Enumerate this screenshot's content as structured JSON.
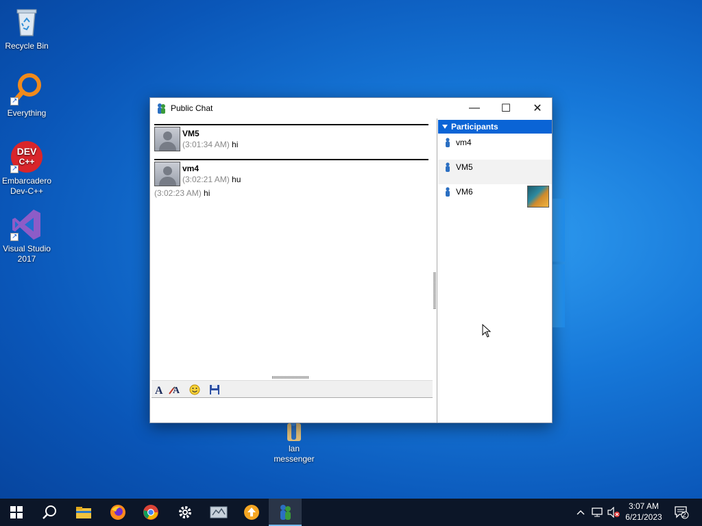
{
  "desktop": {
    "icons": [
      {
        "label_line1": "Recycle Bin",
        "label_line2": "",
        "icon": "recycle-bin-icon"
      },
      {
        "label_line1": "Everything",
        "label_line2": "",
        "icon": "everything-search-icon"
      },
      {
        "label_line1": "Embarcadero",
        "label_line2": "Dev-C++",
        "icon": "dev-cpp-icon",
        "badge": "DEV C++"
      },
      {
        "label_line1": "Visual Studio",
        "label_line2": "2017",
        "icon": "visual-studio-icon"
      },
      {
        "label_line1": "lan",
        "label_line2": "messenger",
        "icon": "lan-messenger-icon"
      }
    ]
  },
  "window": {
    "title": "Public Chat",
    "controls": {
      "minimize": "—",
      "maximize": "☐",
      "close": "✕"
    }
  },
  "messages": [
    {
      "sender": "VM5",
      "lines": [
        {
          "time": "(3:01:34 AM)",
          "text": "hi"
        }
      ]
    },
    {
      "sender": "vm4",
      "lines": [
        {
          "time": "(3:02:21 AM)",
          "text": "hu"
        },
        {
          "time": "(3:02:23 AM)",
          "text": "hi"
        }
      ]
    }
  ],
  "toolbar": {
    "font_icon": "font-icon",
    "font_color_icon": "font-color-icon",
    "emoticon_icon": "smiley-icon",
    "save_icon": "save-icon"
  },
  "participants": {
    "header": "Participants",
    "items": [
      {
        "name": "vm4",
        "has_avatar": false
      },
      {
        "name": "VM5",
        "has_avatar": false
      },
      {
        "name": "VM6",
        "has_avatar": true
      }
    ]
  },
  "taskbar": {
    "apps": [
      "start-icon",
      "search-icon",
      "file-explorer-icon",
      "firefox-icon",
      "chrome-icon",
      "settings-icon",
      "network-app-icon",
      "upload-app-icon",
      "lan-messenger-icon"
    ],
    "time": "3:07 AM",
    "date": "6/21/2023",
    "notification_count": "2"
  },
  "colors": {
    "accent": "#0a64d6",
    "taskbar": "#0c1628",
    "timestamp": "#888888"
  }
}
